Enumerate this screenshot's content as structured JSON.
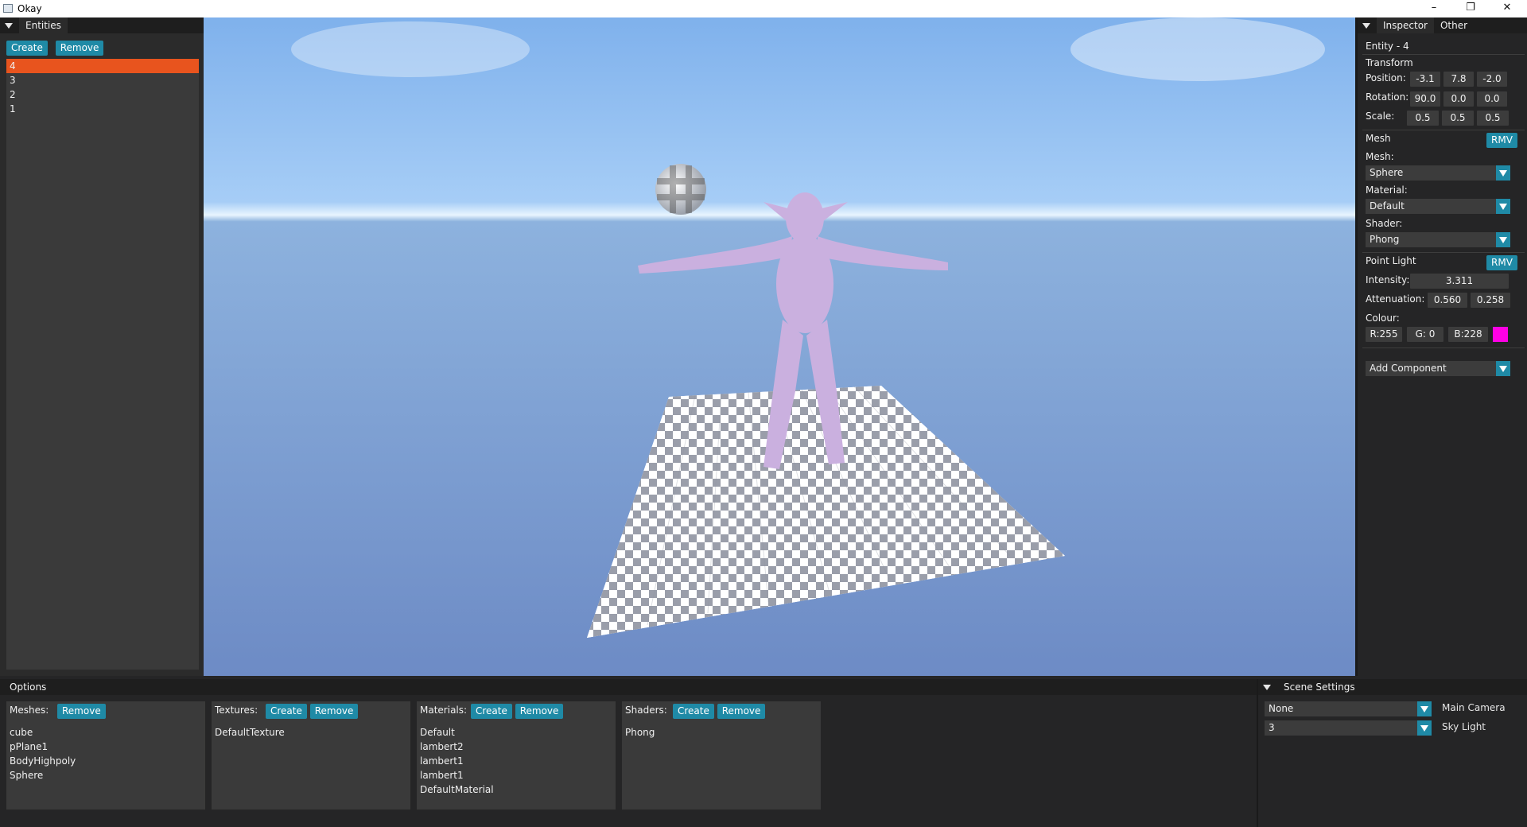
{
  "window": {
    "title": "Okay",
    "minimize": "–",
    "restore": "❐",
    "close": "✕"
  },
  "entities": {
    "tab": "Entities",
    "create_label": "Create",
    "remove_label": "Remove",
    "items": [
      "4",
      "3",
      "2",
      "1"
    ],
    "selected": "4"
  },
  "inspector": {
    "tabs": [
      "Inspector",
      "Other"
    ],
    "entity": "Entity - 4",
    "transform": {
      "label": "Transform",
      "position_label": "Position:",
      "position": [
        "-3.1",
        "7.8",
        "-2.0"
      ],
      "rotation_label": "Rotation:",
      "rotation": [
        "90.0",
        "0.0",
        "0.0"
      ],
      "scale_label": "Scale:",
      "scale": [
        "0.5",
        "0.5",
        "0.5"
      ]
    },
    "mesh": {
      "label": "Mesh",
      "rmv": "RMV",
      "mesh_label": "Mesh:",
      "mesh_value": "Sphere",
      "material_label": "Material:",
      "material_value": "Default",
      "shader_label": "Shader:",
      "shader_value": "Phong"
    },
    "point_light": {
      "label": "Point Light",
      "rmv": "RMV",
      "intensity_label": "Intensity:",
      "intensity": "3.311",
      "attenuation_label": "Attenuation:",
      "attenuation": [
        "0.560",
        "0.258"
      ],
      "colour_label": "Colour:",
      "r": "R:255",
      "g": "G: 0",
      "b": "B:228",
      "swatch": "#ff00e4"
    },
    "add_component": "Add Component"
  },
  "options": {
    "tab": "Options",
    "meshes": {
      "label": "Meshes:",
      "remove": "Remove",
      "items": [
        "cube",
        "pPlane1",
        "BodyHighpoly",
        "Sphere"
      ]
    },
    "textures": {
      "label": "Textures:",
      "create": "Create",
      "remove": "Remove",
      "items": [
        "DefaultTexture"
      ]
    },
    "materials": {
      "label": "Materials:",
      "create": "Create",
      "remove": "Remove",
      "items": [
        "Default",
        "lambert2",
        "lambert1",
        "lambert1",
        "DefaultMaterial"
      ]
    },
    "shaders": {
      "label": "Shaders:",
      "create": "Create",
      "remove": "Remove",
      "items": [
        "Phong"
      ]
    }
  },
  "scene_settings": {
    "tab": "Scene Settings",
    "camera_value": "None",
    "camera_label": "Main Camera",
    "skylight_value": "3",
    "skylight_label": "Sky Light"
  },
  "colors": {
    "accent": "#1f8aa6",
    "selection": "#e8541e",
    "panel": "#2b2b2b"
  }
}
